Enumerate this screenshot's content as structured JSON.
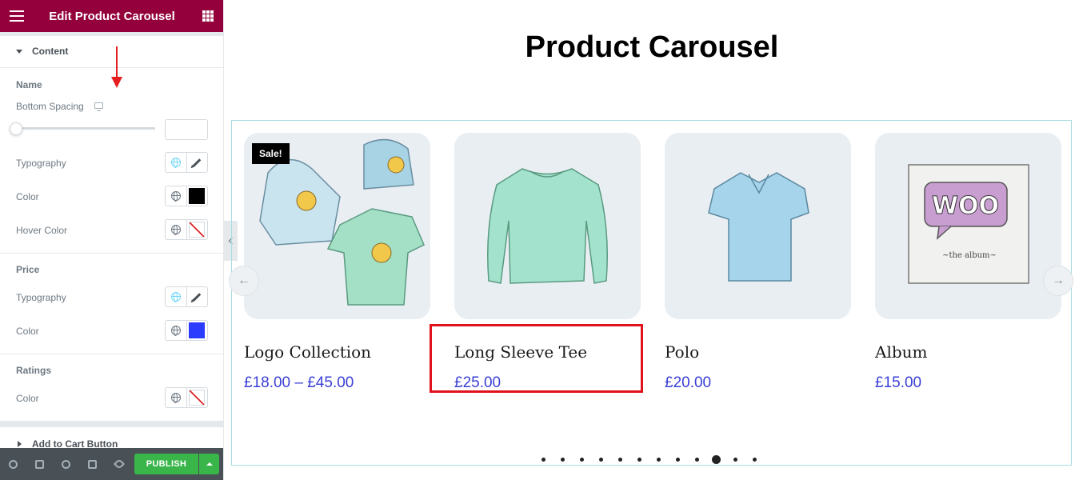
{
  "sidebar": {
    "title": "Edit Product Carousel",
    "content_section": "Content",
    "name_group": {
      "title": "Name",
      "bottom_spacing": "Bottom Spacing",
      "bottom_spacing_value": "",
      "typography": "Typography",
      "color": "Color",
      "color_value": "#000000",
      "hover_color": "Hover Color"
    },
    "price_group": {
      "title": "Price",
      "typography": "Typography",
      "color": "Color",
      "color_value": "#2b3cff"
    },
    "ratings_group": {
      "title": "Ratings",
      "color": "Color"
    },
    "add_to_cart_section": "Add to Cart Button",
    "publish_label": "PUBLISH"
  },
  "preview": {
    "title": "Product Carousel",
    "products": [
      {
        "name": "Logo Collection",
        "price": "£18.00 – £45.00",
        "badge": "Sale!"
      },
      {
        "name": "Long Sleeve Tee",
        "price": "£25.00"
      },
      {
        "name": "Polo",
        "price": "£20.00"
      },
      {
        "name": "Album",
        "price": "£15.00",
        "album_art_text": "WOO",
        "album_caption": "~the album~"
      }
    ],
    "pagination": {
      "count": 12,
      "active_index": 9
    }
  },
  "colors": {
    "header_bg": "#93003c",
    "price_blue": "#3a3fd6",
    "publish_green": "#39b54a",
    "highlight_red": "#e0121b"
  }
}
